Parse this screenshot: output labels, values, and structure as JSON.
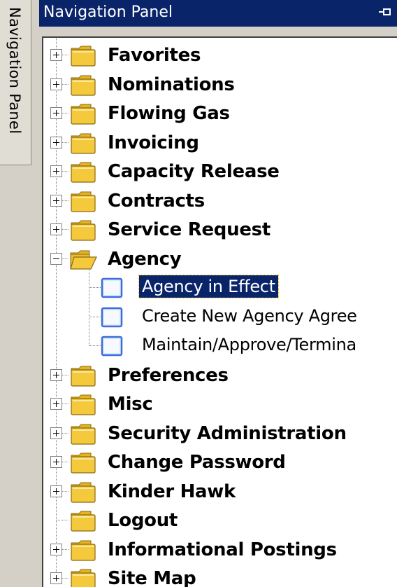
{
  "side_tab": {
    "label": "Navigation Panel"
  },
  "panel": {
    "title": "Navigation Panel"
  },
  "tree": {
    "items": [
      {
        "label": "Favorites",
        "state": "collapsed"
      },
      {
        "label": "Nominations",
        "state": "collapsed"
      },
      {
        "label": "Flowing Gas",
        "state": "collapsed"
      },
      {
        "label": "Invoicing",
        "state": "collapsed"
      },
      {
        "label": "Capacity Release",
        "state": "collapsed"
      },
      {
        "label": "Contracts",
        "state": "collapsed"
      },
      {
        "label": "Service Request",
        "state": "collapsed"
      },
      {
        "label": "Agency",
        "state": "expanded",
        "children": [
          {
            "label": "Agency in Effect",
            "selected": true
          },
          {
            "label": "Create New Agency Agree"
          },
          {
            "label": "Maintain/Approve/Termina"
          }
        ]
      },
      {
        "label": "Preferences",
        "state": "collapsed"
      },
      {
        "label": "Misc",
        "state": "collapsed"
      },
      {
        "label": "Security Administration",
        "state": "collapsed"
      },
      {
        "label": "Change Password",
        "state": "collapsed"
      },
      {
        "label": "Kinder Hawk",
        "state": "collapsed"
      },
      {
        "label": "Logout",
        "state": "leaf"
      },
      {
        "label": "Informational Postings",
        "state": "collapsed"
      },
      {
        "label": "Site Map",
        "state": "collapsed"
      }
    ]
  },
  "colors": {
    "title_bar": "#0a246a",
    "selection": "#0a246a",
    "folder": "#f4c93c",
    "background": "#d4d0c8"
  }
}
